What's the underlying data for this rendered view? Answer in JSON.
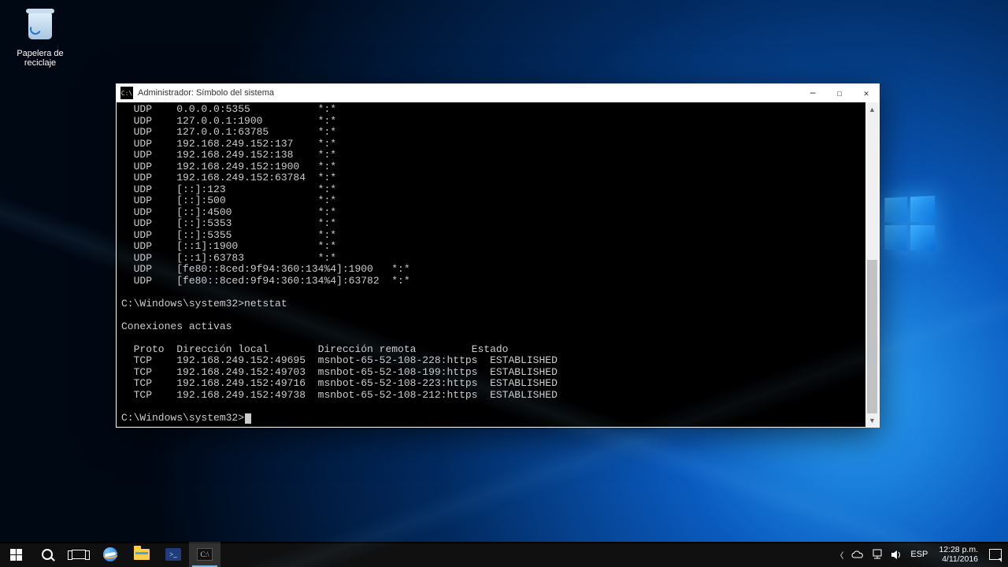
{
  "desktop": {
    "recycle_bin_label": "Papelera de\nreciclaje"
  },
  "window": {
    "title": "Administrador: Símbolo del sistema"
  },
  "terminal": {
    "udp_lines": [
      "  UDP    0.0.0.0:5355           *:*",
      "  UDP    127.0.0.1:1900         *:*",
      "  UDP    127.0.0.1:63785        *:*",
      "  UDP    192.168.249.152:137    *:*",
      "  UDP    192.168.249.152:138    *:*",
      "  UDP    192.168.249.152:1900   *:*",
      "  UDP    192.168.249.152:63784  *:*",
      "  UDP    [::]:123               *:*",
      "  UDP    [::]:500               *:*",
      "  UDP    [::]:4500              *:*",
      "  UDP    [::]:5353              *:*",
      "  UDP    [::]:5355              *:*",
      "  UDP    [::1]:1900             *:*",
      "  UDP    [::1]:63783            *:*",
      "  UDP    [fe80::8ced:9f94:360:134%4]:1900   *:*",
      "  UDP    [fe80::8ced:9f94:360:134%4]:63782  *:*"
    ],
    "prompt1": "C:\\Windows\\system32>netstat",
    "blank1": "",
    "heading": "Conexiones activas",
    "blank2": "",
    "columns": "  Proto  Dirección local        Dirección remota         Estado",
    "tcp_lines": [
      "  TCP    192.168.249.152:49695  msnbot-65-52-108-228:https  ESTABLISHED",
      "  TCP    192.168.249.152:49703  msnbot-65-52-108-199:https  ESTABLISHED",
      "  TCP    192.168.249.152:49716  msnbot-65-52-108-223:https  ESTABLISHED",
      "  TCP    192.168.249.152:49738  msnbot-65-52-108-212:https  ESTABLISHED"
    ],
    "prompt2": "C:\\Windows\\system32>"
  },
  "tray": {
    "lang": "ESP",
    "time": "12:28 p.m.",
    "date": "4/11/2016"
  }
}
